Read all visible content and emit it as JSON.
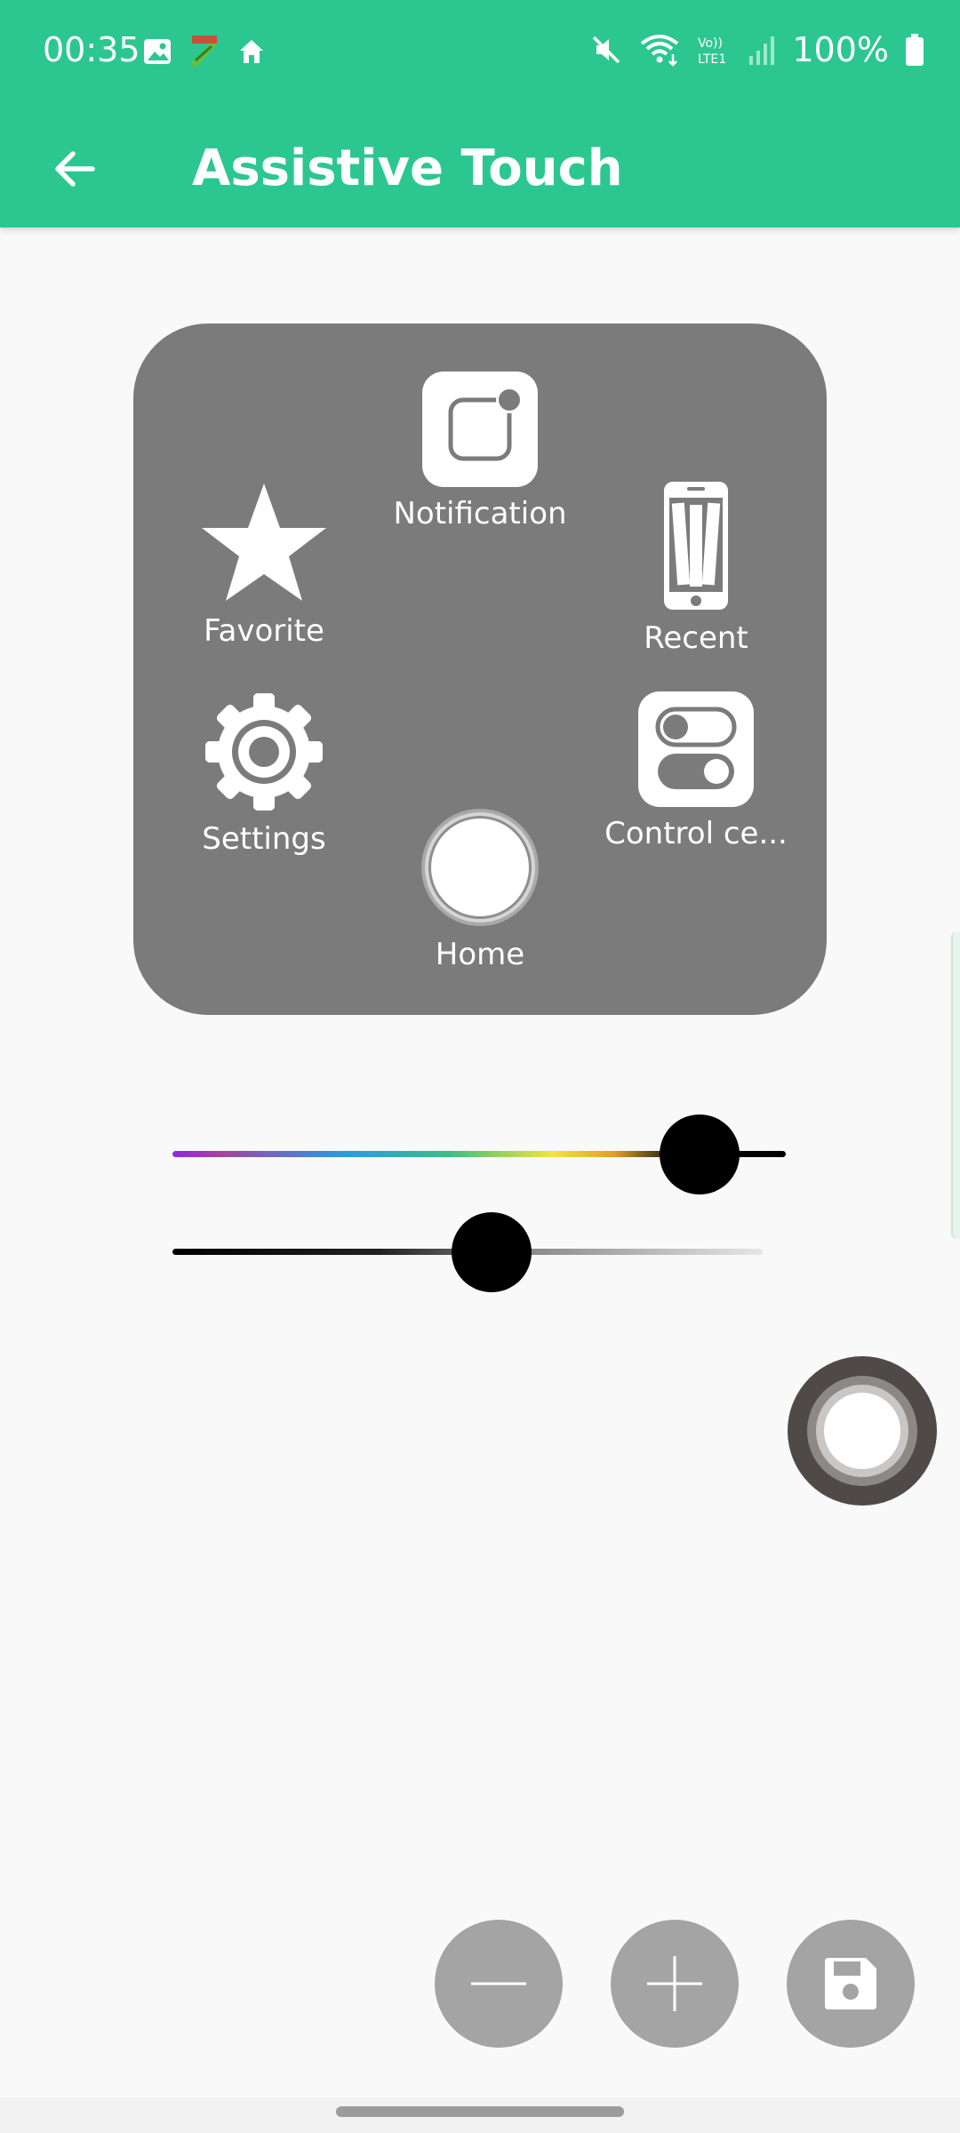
{
  "status_bar": {
    "time": "00:35",
    "battery_percent": "100%",
    "left_icons": [
      "gallery-icon",
      "fake-gps-icon",
      "home-icon"
    ],
    "right_icons": [
      "mute-icon",
      "wifi-icon",
      "volte-lte-icon",
      "signal-icon",
      "battery-icon"
    ]
  },
  "app_bar": {
    "title": "Assistive Touch",
    "back_icon": "arrow-left-icon"
  },
  "menu_preview": {
    "items": [
      {
        "id": "notification",
        "label": "Notification",
        "icon": "notification-icon"
      },
      {
        "id": "favorite",
        "label": "Favorite",
        "icon": "star-icon"
      },
      {
        "id": "recent",
        "label": "Recent",
        "icon": "phone-recent-icon"
      },
      {
        "id": "settings",
        "label": "Settings",
        "icon": "gear-icon"
      },
      {
        "id": "control_center",
        "label": "Control ce...",
        "icon": "toggle-icon"
      },
      {
        "id": "home",
        "label": "Home",
        "icon": "home-button-icon"
      }
    ]
  },
  "sliders": {
    "color": {
      "value": 0.86
    },
    "opacity": {
      "value": 0.52
    }
  },
  "actions": [
    {
      "id": "decrease",
      "icon": "minus-icon"
    },
    {
      "id": "increase",
      "icon": "plus-icon"
    },
    {
      "id": "save",
      "icon": "save-icon"
    }
  ],
  "colors": {
    "accent": "#2cc790",
    "panel": "#7b7b7b",
    "action_button": "#a4a4a4",
    "float_button": "#4f4a48"
  }
}
